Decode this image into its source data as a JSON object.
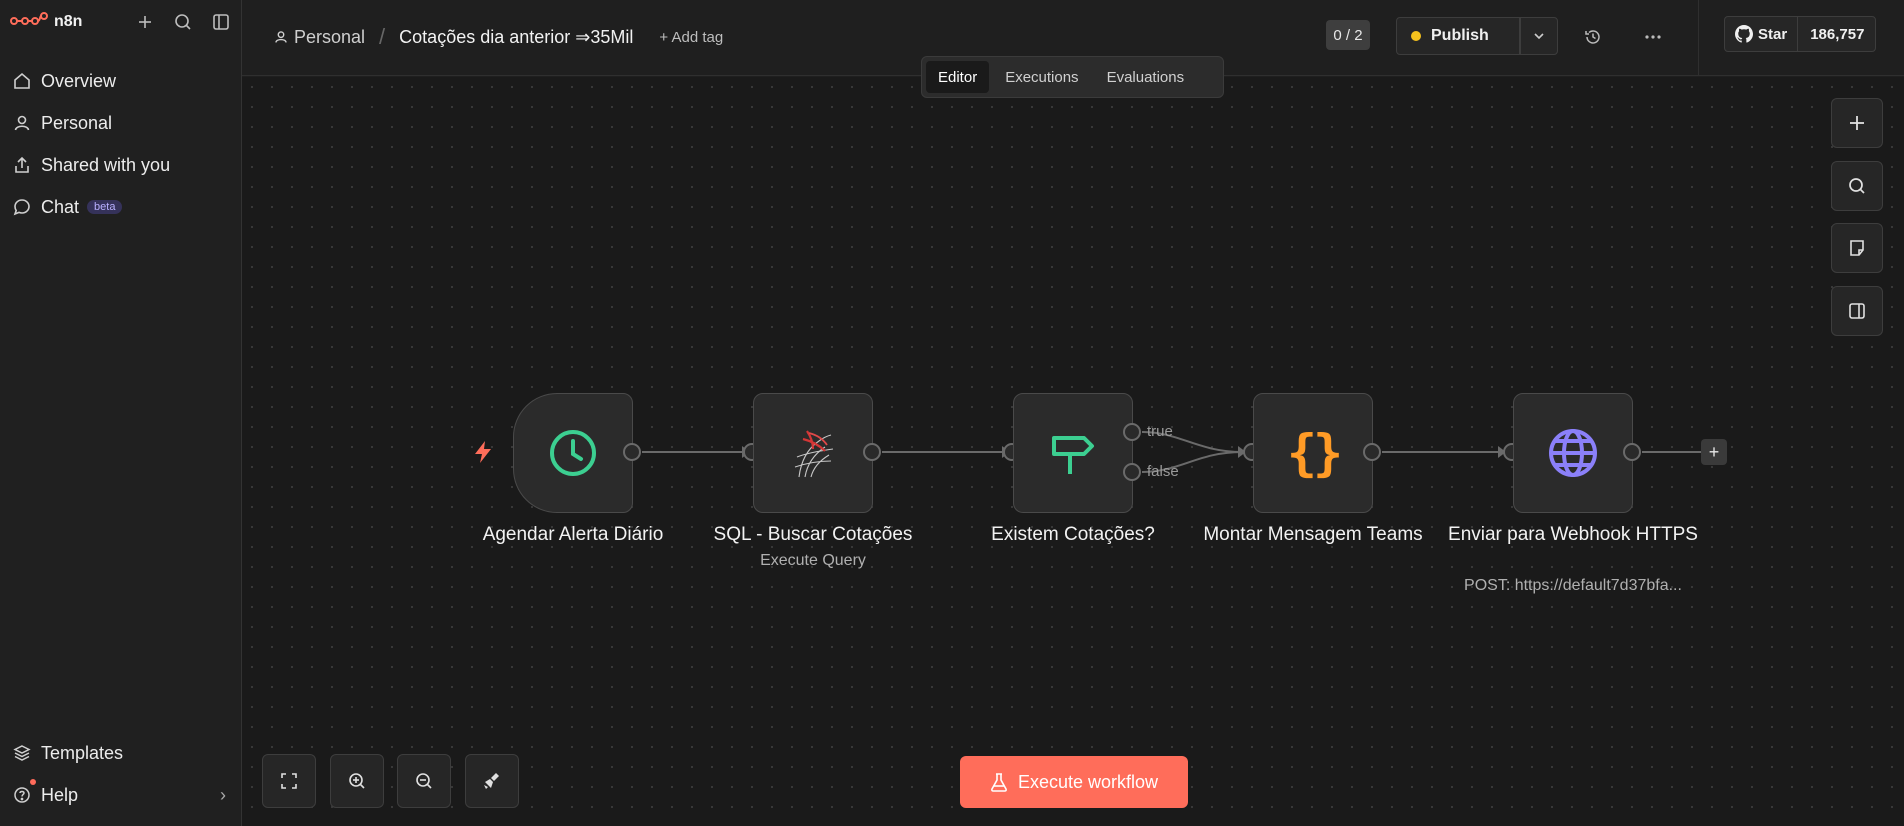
{
  "app": {
    "logo_text": "n8n"
  },
  "sidebar": {
    "items": [
      {
        "label": "Overview",
        "icon": "home-icon"
      },
      {
        "label": "Personal",
        "icon": "user-icon"
      },
      {
        "label": "Shared with you",
        "icon": "share-icon"
      },
      {
        "label": "Chat",
        "icon": "chat-icon",
        "badge": "beta"
      }
    ],
    "bottom": [
      {
        "label": "Templates",
        "icon": "templates-icon"
      },
      {
        "label": "Help",
        "icon": "help-icon"
      }
    ]
  },
  "header": {
    "project": "Personal",
    "workflow_title": "Cotações dia anterior ⇒35Mil",
    "add_tag": "+ Add tag",
    "counter": "0 / 2",
    "publish": "Publish",
    "github_star": "Star",
    "github_count": "186,757"
  },
  "tabs": [
    {
      "label": "Editor",
      "active": true
    },
    {
      "label": "Executions",
      "active": false
    },
    {
      "label": "Evaluations",
      "active": false
    }
  ],
  "workflow": {
    "nodes": [
      {
        "title": "Agendar Alerta Diário",
        "subtitle": "",
        "icon": "clock-icon"
      },
      {
        "title": "SQL - Buscar Cotações",
        "subtitle": "Execute Query",
        "icon": "sql-server-icon"
      },
      {
        "title": "Existem Cotações?",
        "subtitle": "",
        "icon": "signpost-icon"
      },
      {
        "title": "Montar Mensagem Teams",
        "subtitle": "",
        "icon": "code-braces-icon"
      },
      {
        "title": "Enviar para Webhook HTTPS",
        "subtitle": "POST: https://default7d37bfa...",
        "icon": "globe-icon"
      }
    ],
    "branch_true": "true",
    "branch_false": "false"
  },
  "actions": {
    "execute_workflow": "Execute workflow"
  },
  "colors": {
    "accent": "#ff6d5a",
    "publish_dot": "#f6c21d",
    "clock": "#3ccf91",
    "signpost": "#3ccf91",
    "braces": "#ff9b26",
    "globe": "#8b80f9"
  }
}
